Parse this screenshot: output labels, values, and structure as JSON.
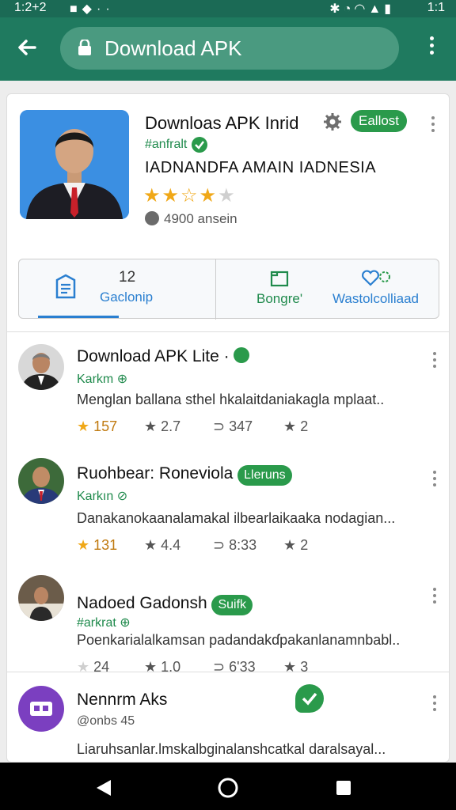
{
  "status_bar": {
    "time": "1:2+2",
    "icons": [
      "camera-icon",
      "location-icon",
      "dots-icon"
    ],
    "right_icons": [
      "bluetooth-icon",
      "alarm-icon",
      "wifi-icon",
      "signal-icon",
      "battery-icon"
    ],
    "right_time": "1:1"
  },
  "app_bar": {
    "url_text": "Download APK",
    "back_icon": "back-arrow-icon",
    "lock_icon": "lock-icon",
    "menu_icon": "more-vert-icon"
  },
  "featured": {
    "title": "Downloas APK Inrid",
    "badge": "Eallost",
    "developer": "#anfralt",
    "subtitle": "IADNANDFA AMAIN IADNESIA",
    "rating_stars": [
      1,
      1,
      0,
      1,
      0
    ],
    "installs": "4900 ansein"
  },
  "tabs": [
    {
      "label": "Gaclonip",
      "count": "12",
      "icon": "document-icon",
      "color": "#2a7fd0"
    },
    {
      "label": "Bongre'",
      "icon": "window-icon",
      "color": "#1f8a4c"
    },
    {
      "label": "Wastolcolliaad",
      "icon": "heart-icon",
      "color": "#2a7fd0"
    }
  ],
  "items": [
    {
      "title": "Download APK Lite ·",
      "badge": "",
      "developer": "Karkm",
      "description": "Menglan ballana sthel hkalaitdaniakagla mplaat..",
      "stats": {
        "rating": "157",
        "rating_star": "on",
        "score": "2.7",
        "comments": "347",
        "saves": "2"
      }
    },
    {
      "title": "Ruohbear: Roneviola",
      "badge": "Ŀleruns",
      "developer": "Karkın",
      "description": "Danakanokaanalamakal ilbearlaikaaka nodagian...",
      "stats": {
        "rating": "131",
        "rating_star": "on",
        "score": "4.4",
        "comments": "8:33",
        "saves": "2"
      }
    },
    {
      "title": "Nadoed Gadonsh",
      "badge": "Suifk",
      "developer": "#arkrat",
      "description": "Poenkarialalkamsan padandakɗpakanlanamnbabl..",
      "stats": {
        "rating": "24",
        "rating_star": "off",
        "score": "1.0",
        "comments": "6'33",
        "saves": "3"
      }
    },
    {
      "title": "Nennrm Aks",
      "developer": "@onbs 45",
      "description": "Liaruhsanlar.lmskalbginalanshcatkal daralsayal..."
    }
  ],
  "colors": {
    "app_bar": "#1f7a5f",
    "status_bar": "#1b6a55",
    "accent_green": "#2a9a4b",
    "star": "#f0a818",
    "tab_blue": "#2a7fd0"
  },
  "nav": [
    "back-triangle-icon",
    "home-circle-icon",
    "recents-square-icon"
  ]
}
